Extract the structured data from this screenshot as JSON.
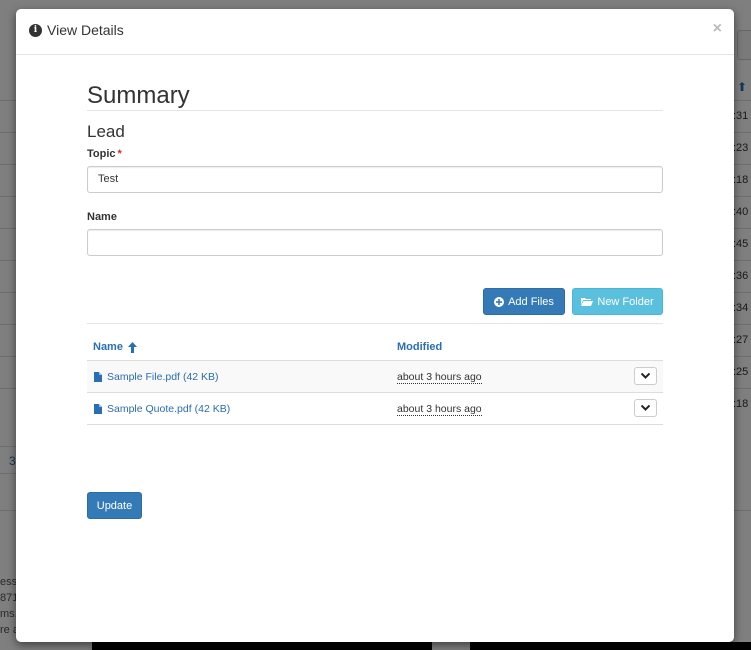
{
  "modal": {
    "title": "View Details",
    "close_label": "×"
  },
  "form": {
    "section_title": "Summary",
    "entity_title": "Lead",
    "topic_label": "Topic",
    "required_marker": "*",
    "topic_value": "Test",
    "name_label": "Name",
    "name_value": ""
  },
  "toolbar": {
    "add_files_label": "Add Files",
    "new_folder_label": "New Folder"
  },
  "files": {
    "columns": {
      "name": "Name",
      "modified": "Modified"
    },
    "rows": [
      {
        "name": "Sample File.pdf",
        "size": "(42 KB)",
        "modified": "about 3 hours ago"
      },
      {
        "name": "Sample Quote.pdf",
        "size": "(42 KB)",
        "modified": "about 3 hours ago"
      }
    ]
  },
  "actions": {
    "update_label": "Update"
  },
  "colors": {
    "primary": "#337ab7",
    "info": "#5bc0de",
    "link": "#2a6eb3",
    "required": "#c9302c"
  }
}
